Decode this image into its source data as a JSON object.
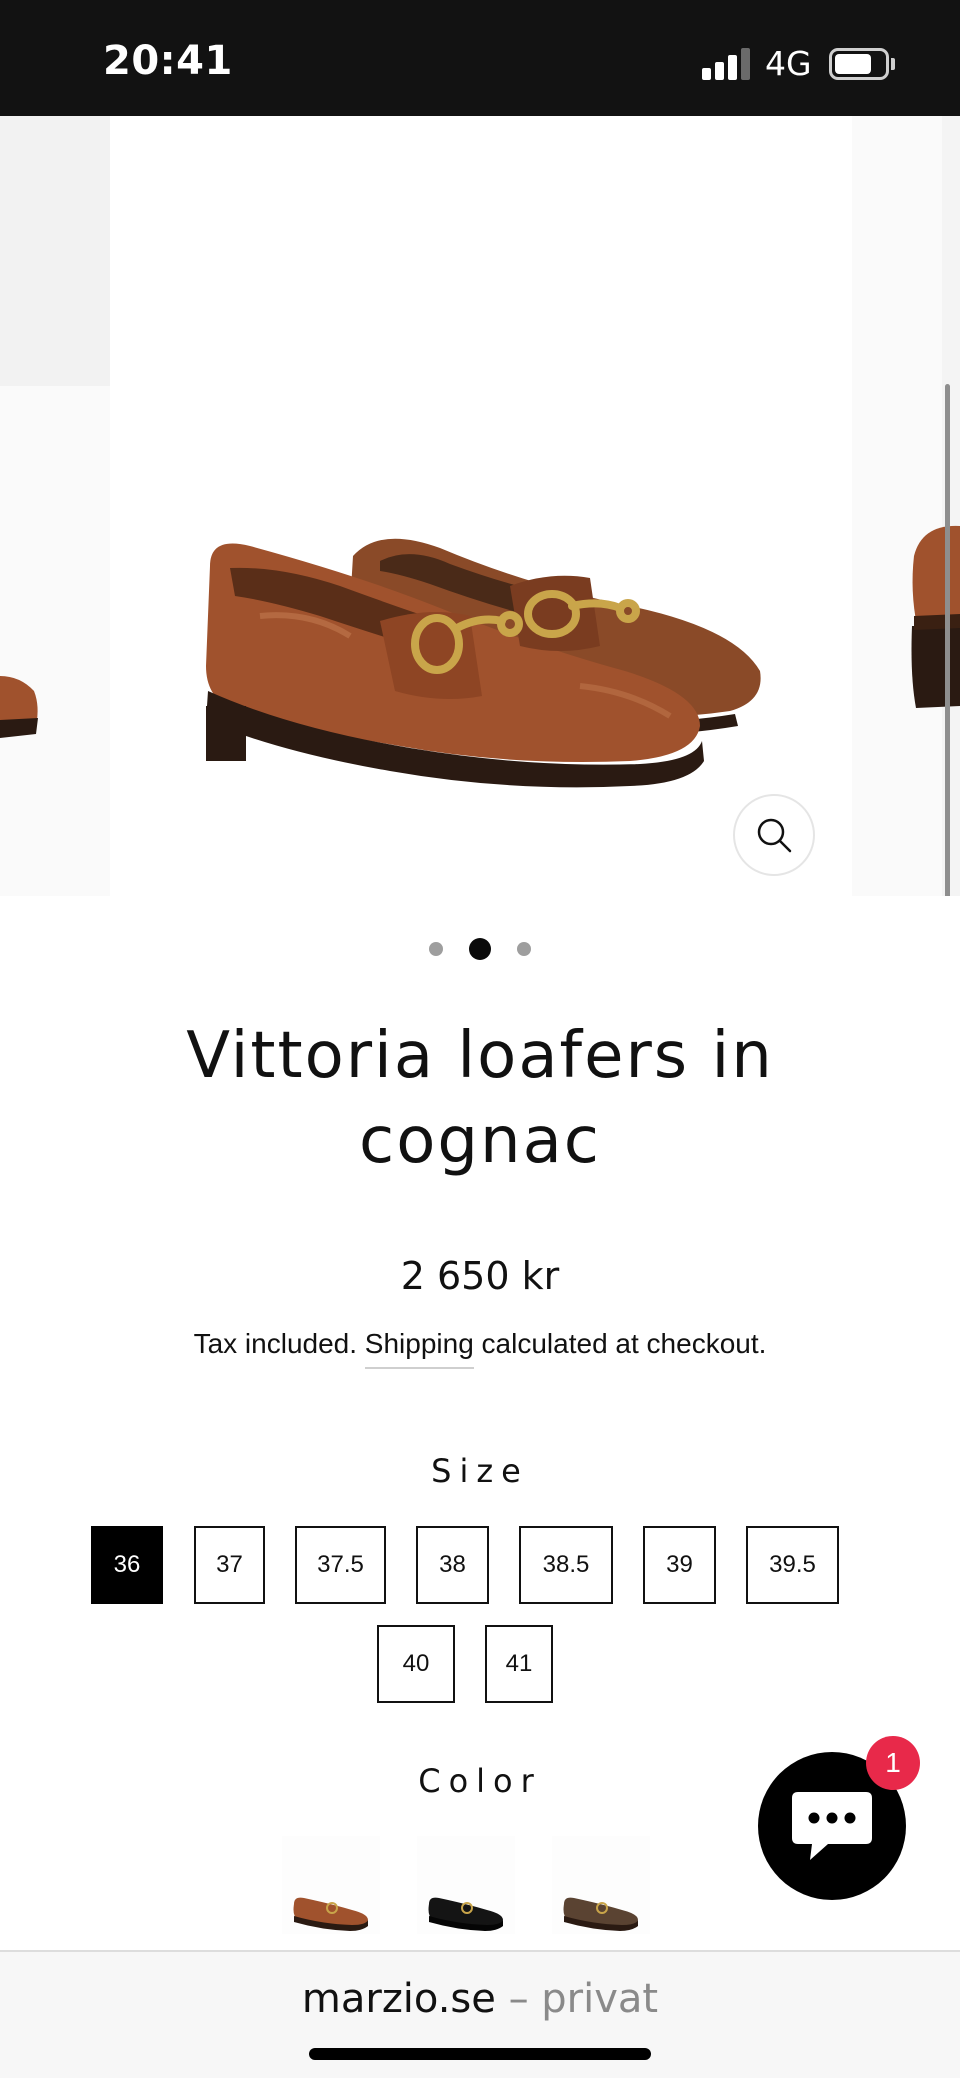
{
  "status_bar": {
    "time": "20:41",
    "network": "4G",
    "signal_bars_active": 3,
    "signal_bars_total": 4
  },
  "gallery": {
    "slide_count": 3,
    "active_slide_index": 1,
    "zoom_icon": "search-icon"
  },
  "product": {
    "title": "Vittoria loafers in cognac",
    "price": "2 650 kr",
    "tax_note": {
      "before": "Tax included. ",
      "link": "Shipping",
      "after": " calculated at checkout."
    }
  },
  "size": {
    "label": "Size",
    "options": [
      "36",
      "37",
      "37.5",
      "38",
      "38.5",
      "39",
      "39.5",
      "40",
      "41"
    ],
    "selected": "36"
  },
  "color": {
    "label": "Color",
    "swatches": [
      {
        "name": "cognac",
        "color": "#a0522d"
      },
      {
        "name": "black",
        "color": "#141414"
      },
      {
        "name": "brown",
        "color": "#5a4332"
      }
    ]
  },
  "chat": {
    "badge_count": "1",
    "icon": "chat-icon"
  },
  "browser": {
    "domain": "marzio.se",
    "suffix": " – privat"
  },
  "colors": {
    "status_bar_bg": "#121212",
    "chat_bg": "#000000",
    "badge_bg": "#e8294a",
    "shoe_cognac": "#a0522d",
    "sole_dark": "#2a1a12",
    "buckle_gold": "#c9a54a"
  }
}
